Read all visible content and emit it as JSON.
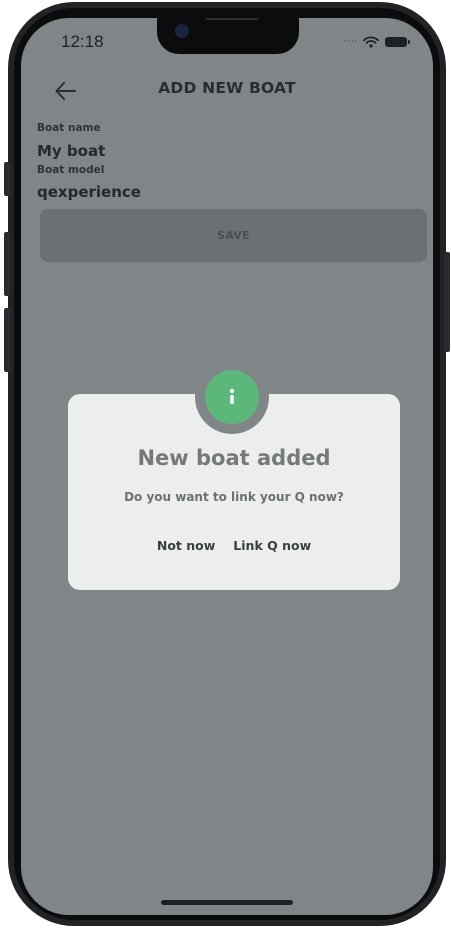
{
  "status_bar": {
    "time": "12:18",
    "signal_icon": "signal-dots-icon",
    "wifi_icon": "wifi-icon",
    "battery_icon": "battery-icon"
  },
  "header": {
    "back_icon": "arrow-left-icon",
    "title": "ADD NEW BOAT"
  },
  "form": {
    "boat_name_label": "Boat name",
    "boat_name_value": "My boat",
    "boat_model_label": "Boat model",
    "boat_model_value": "qexperience",
    "save_label": "SAVE"
  },
  "dialog": {
    "icon": "info-icon",
    "icon_glyph": "i",
    "title": "New boat added",
    "message": "Do you want to link your Q now?",
    "secondary_label": "Not now",
    "primary_label": "Link Q now"
  },
  "colors": {
    "overlay": "#808588",
    "accent_green": "#5cb87a",
    "dialog_bg": "#eceded",
    "save_button_bg": "#6b7073"
  }
}
